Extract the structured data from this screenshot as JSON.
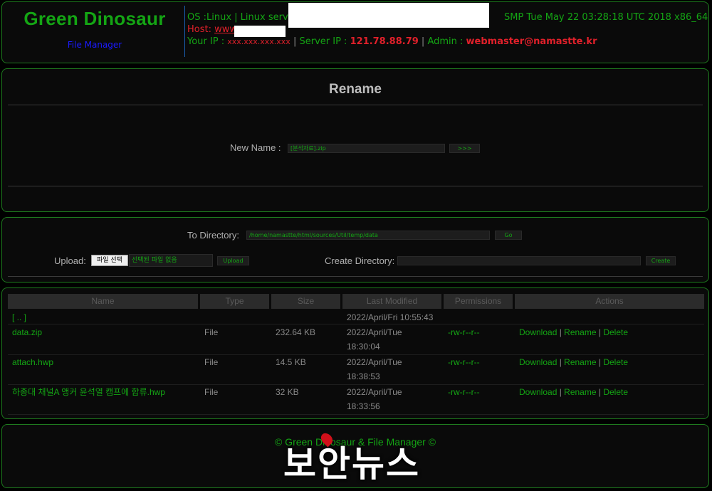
{
  "header": {
    "site_title": "Green Dinosaur",
    "file_manager_link": "File Manager",
    "os_line_prefix": "OS :Linux | Linux servera",
    "os_line_suffix": "SMP Tue May 22 03:28:18 UTC 2018 x86_64",
    "host_label": "Host: ",
    "host_value": "www.",
    "your_ip_label": "Your IP : ",
    "your_ip_value": "xxx.xxx.xxx.xxx",
    "sep1": " | ",
    "server_ip_label": "Server IP : ",
    "server_ip_value": "121.78.88.79",
    "sep2": " | ",
    "admin_label": "Admin : ",
    "admin_value": "webmaster@namastte.kr"
  },
  "rename": {
    "title": "Rename",
    "new_name_label": "New Name :",
    "new_name_value": "[분석자료].zip",
    "submit_label": ">>>"
  },
  "directory": {
    "to_directory_label": "To Directory:",
    "path_value": "/home/namastte/html/sources/Util/temp/data",
    "go_label": "Go",
    "upload_label": "Upload:",
    "choose_file_label": "파일 선택",
    "no_file_text": "선택된 파일 없음",
    "upload_button": "Upload",
    "create_dir_label": "Create Directory:",
    "create_dir_value": "",
    "create_button": "Create"
  },
  "table": {
    "headers": [
      "Name",
      "Type",
      "Size",
      "Last Modified",
      "Permissions",
      "Actions"
    ],
    "parent": {
      "name": "[ .. ]",
      "modified": "2022/April/Fri 10:55:43"
    },
    "rows": [
      {
        "name": "data.zip",
        "type": "File",
        "size": "232.64 KB",
        "mod1": "2022/April/Tue",
        "mod2": "18:30:04",
        "perm": "-rw-r--r--"
      },
      {
        "name": "attach.hwp",
        "type": "File",
        "size": "14.5 KB",
        "mod1": "2022/April/Tue",
        "mod2": "18:38:53",
        "perm": "-rw-r--r--"
      },
      {
        "name": "하종대 채널A 앵커 윤석열 캠프에 합류.hwp",
        "type": "File",
        "size": "32 KB",
        "mod1": "2022/April/Tue",
        "mod2": "18:33:56",
        "perm": "-rw-r--r--"
      }
    ],
    "actions": {
      "download": "Download",
      "rename": "Rename",
      "delete": "Delete",
      "sep": " | "
    }
  },
  "footer": {
    "copyright": "© Green Dinosaur & File Manager ©"
  },
  "watermark": "보안뉴스"
}
